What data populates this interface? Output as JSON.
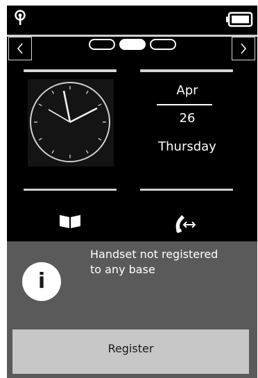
{
  "status_bar": {
    "signal_icon": "antenna-signal-icon",
    "battery_icon": "battery-icon"
  },
  "navigation": {
    "prev_icon": "chevron-left-icon",
    "next_icon": "chevron-right-icon",
    "page_count": 3,
    "active_page": 2
  },
  "date_widget": {
    "month": "Apr",
    "day": "26",
    "weekday": "Thursday"
  },
  "clock_widget": {
    "hour_hand": "10:00",
    "minute_hand": "09"
  },
  "shortcuts": {
    "left_icon": "phonebook-icon",
    "right_icon": "call-transfer-icon"
  },
  "notification": {
    "icon": "info-icon",
    "message_line1": "Handset not registered",
    "message_line2": "to any base",
    "register_label": "Register"
  },
  "colors": {
    "background": "#000000",
    "panel": "#5a5a5a",
    "button": "#c7c7c7",
    "text": "#ffffff"
  }
}
